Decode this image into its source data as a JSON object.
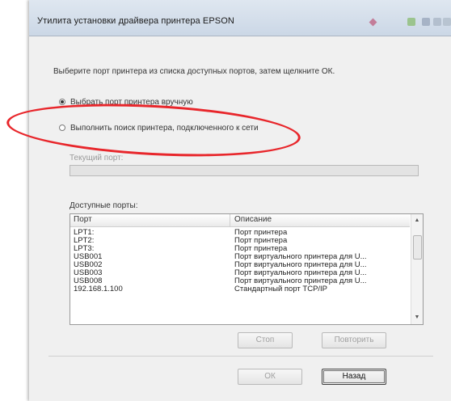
{
  "window": {
    "title": "Утилита установки драйвера принтера EPSON"
  },
  "dialog": {
    "instruction": "Выберите порт принтера из списка доступных портов, затем щелкните ОК.",
    "radio_manual": {
      "label": "Выбрать порт принтера вручную",
      "checked": true
    },
    "radio_search": {
      "label": "Выполнить поиск принтера, подключенного к сети",
      "checked": false
    },
    "current_port_label": "Текущий порт:",
    "current_port_value": "",
    "available_ports_label": "Доступные порты:",
    "ports_table": {
      "columns": [
        "Порт",
        "Описание"
      ],
      "rows": [
        {
          "port": "LPT1:",
          "description": "Порт принтера"
        },
        {
          "port": "LPT2:",
          "description": "Порт принтера"
        },
        {
          "port": "LPT3:",
          "description": "Порт принтера"
        },
        {
          "port": "USB001",
          "description": "Порт виртуального принтера для U..."
        },
        {
          "port": "USB002",
          "description": "Порт виртуального принтера для U..."
        },
        {
          "port": "USB003",
          "description": "Порт виртуального принтера для U..."
        },
        {
          "port": "USB008",
          "description": "Порт виртуального принтера для U..."
        },
        {
          "port": "192.168.1.100",
          "description": "Стандартный порт TCP/IP"
        }
      ]
    },
    "buttons": {
      "stop": "Стоп",
      "retry": "Повторить",
      "ok": "ОК",
      "back": "Назад"
    }
  },
  "annotation_color": "#e8262b"
}
